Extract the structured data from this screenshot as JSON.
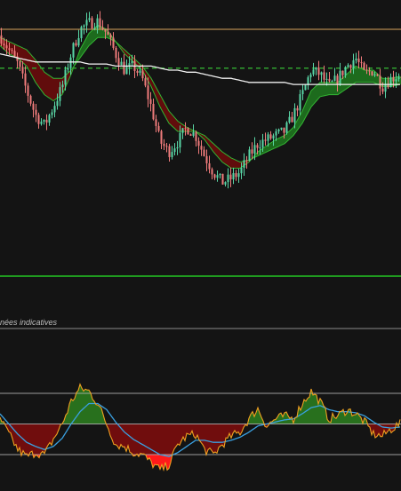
{
  "caption": "nées indicatives",
  "colors": {
    "background": "#141414",
    "candle_up": "#59d6a6",
    "candle_down": "#f07b7b",
    "cloud_bull": "#1e7a1e",
    "cloud_bear": "#6e0a0a",
    "cloud_line": "#33b533",
    "moving_average": "#f2f2f2",
    "level_line": "#d9a45c",
    "dashed_level": "#2fa02f",
    "separator": "#1f9a1f",
    "oscillator_line": "#f0a020",
    "oscillator_signal": "#3aa0e0",
    "oscillator_bull_fill": "#2a7a1e",
    "oscillator_bear_fill": "#7a0c0c",
    "oscillator_extreme_fill": "#ff1a1a",
    "band_lines": "#bdbdbd"
  },
  "chart_data": [
    {
      "type": "candlestick",
      "title": "",
      "description": "price candles with a two-line moving-average cloud, a slow moving average and two horizontal levels; axes have no printed labels",
      "x": [
        0,
        10,
        20,
        30,
        40,
        50,
        60,
        70,
        80,
        90,
        100,
        110,
        120,
        130,
        140,
        150,
        160,
        170,
        180,
        190,
        200,
        210,
        220,
        230,
        240,
        250,
        260,
        270,
        280,
        290,
        300,
        310,
        320,
        330,
        340,
        350,
        360,
        370,
        380,
        390,
        400,
        410,
        420,
        430,
        440,
        450
      ],
      "ylim": [
        0,
        100
      ],
      "series": [
        {
          "role": "close",
          "values": [
            87,
            80,
            73,
            60,
            48,
            43,
            52,
            62,
            78,
            90,
            93,
            94,
            88,
            78,
            70,
            72,
            66,
            52,
            35,
            30,
            35,
            42,
            38,
            28,
            20,
            15,
            17,
            20,
            28,
            34,
            36,
            38,
            40,
            48,
            58,
            70,
            68,
            62,
            66,
            72,
            76,
            68,
            70,
            62,
            66,
            68
          ]
        },
        {
          "role": "cloud_fast",
          "values": [
            82,
            78,
            76,
            72,
            64,
            58,
            55,
            58,
            68,
            80,
            88,
            92,
            90,
            84,
            78,
            74,
            70,
            62,
            52,
            44,
            40,
            40,
            40,
            36,
            30,
            25,
            22,
            22,
            25,
            30,
            33,
            36,
            38,
            42,
            50,
            60,
            64,
            64,
            64,
            68,
            72,
            70,
            70,
            66,
            66,
            67
          ]
        },
        {
          "role": "cloud_slow",
          "values": [
            86,
            84,
            82,
            80,
            75,
            69,
            66,
            66,
            70,
            76,
            82,
            86,
            86,
            84,
            80,
            76,
            72,
            66,
            58,
            50,
            45,
            42,
            40,
            38,
            34,
            30,
            27,
            25,
            26,
            28,
            30,
            32,
            34,
            38,
            44,
            52,
            57,
            58,
            58,
            61,
            64,
            64,
            64,
            62,
            62,
            63
          ]
        },
        {
          "role": "moving_average",
          "values": [
            78,
            77,
            76,
            75,
            74,
            74,
            74,
            74,
            74,
            74,
            73,
            73,
            73,
            72,
            72,
            72,
            72,
            72,
            71,
            70,
            70,
            69,
            69,
            68,
            67,
            66,
            66,
            65,
            64,
            64,
            64,
            64,
            64,
            63,
            63,
            63,
            63,
            63,
            63,
            63,
            63,
            63,
            63,
            63,
            63,
            63
          ]
        },
        {
          "role": "upper_level",
          "values": [
            90
          ]
        },
        {
          "role": "dashed_level",
          "values": [
            71
          ]
        }
      ]
    },
    {
      "type": "area",
      "title": "",
      "description": "oscillator with signal line, shaded above and below a mid line, between two bands; axes have no printed labels",
      "x": [
        0,
        10,
        20,
        30,
        40,
        50,
        60,
        70,
        80,
        90,
        100,
        110,
        120,
        130,
        140,
        150,
        160,
        170,
        180,
        190,
        200,
        210,
        220,
        230,
        240,
        250,
        260,
        270,
        280,
        290,
        300,
        310,
        320,
        330,
        340,
        350,
        360,
        370,
        380,
        390,
        400,
        410,
        420,
        430,
        440,
        450
      ],
      "ylim": [
        0,
        100
      ],
      "bands": [
        80,
        50,
        20
      ],
      "series": [
        {
          "role": "oscillator",
          "values": [
            55,
            40,
            25,
            18,
            22,
            20,
            35,
            50,
            72,
            85,
            82,
            70,
            50,
            30,
            28,
            22,
            20,
            12,
            5,
            10,
            30,
            38,
            40,
            25,
            20,
            30,
            38,
            42,
            55,
            65,
            48,
            55,
            58,
            55,
            70,
            82,
            72,
            55,
            58,
            64,
            60,
            52,
            40,
            38,
            45,
            50
          ]
        },
        {
          "role": "signal",
          "values": [
            60,
            50,
            40,
            32,
            28,
            25,
            28,
            36,
            50,
            62,
            70,
            70,
            64,
            52,
            42,
            35,
            30,
            25,
            20,
            18,
            22,
            28,
            34,
            34,
            32,
            32,
            34,
            37,
            42,
            48,
            50,
            52,
            54,
            55,
            60,
            66,
            68,
            64,
            62,
            62,
            61,
            58,
            52,
            47,
            46,
            47
          ]
        }
      ]
    }
  ]
}
